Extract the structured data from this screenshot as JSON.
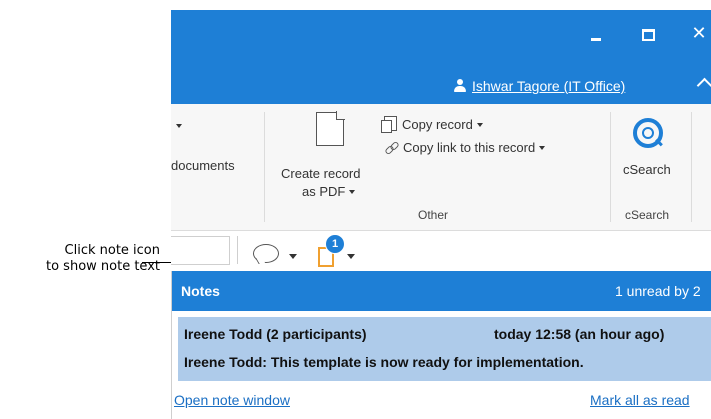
{
  "callout": {
    "line1": "Click note icon",
    "line2": "to show note text"
  },
  "titlebar": {
    "user_name": "Ishwar Tagore (IT Office)",
    "close_glyph": "✕"
  },
  "ribbon": {
    "documents_label": "documents",
    "create_pdf_line1": "Create record",
    "create_pdf_line2": "as PDF",
    "copy_record": "Copy record",
    "copy_link": "Copy link to this record",
    "csearch_label": "cSearch",
    "group_other": "Other",
    "group_csearch": "cSearch"
  },
  "toolbar": {
    "note_badge_count": "1"
  },
  "notes": {
    "header_title": "Notes",
    "unread_text": "1 unread by 2",
    "item": {
      "author": "Ireene Todd (2 participants)",
      "time": "today 12:58 (an hour ago)",
      "text": "Ireene Todd: This template is now ready for implementation."
    },
    "open_link": "Open note window",
    "mark_read_link": "Mark all as read"
  },
  "colors": {
    "accent": "#1e7fd6",
    "note_highlight": "#aecbea",
    "badge_doc": "#f0a030"
  },
  "icons": [
    "user-icon",
    "pdf-icon",
    "copy-icon",
    "link-icon",
    "csearch-icon",
    "speech-bubble-icon",
    "note-icon"
  ]
}
